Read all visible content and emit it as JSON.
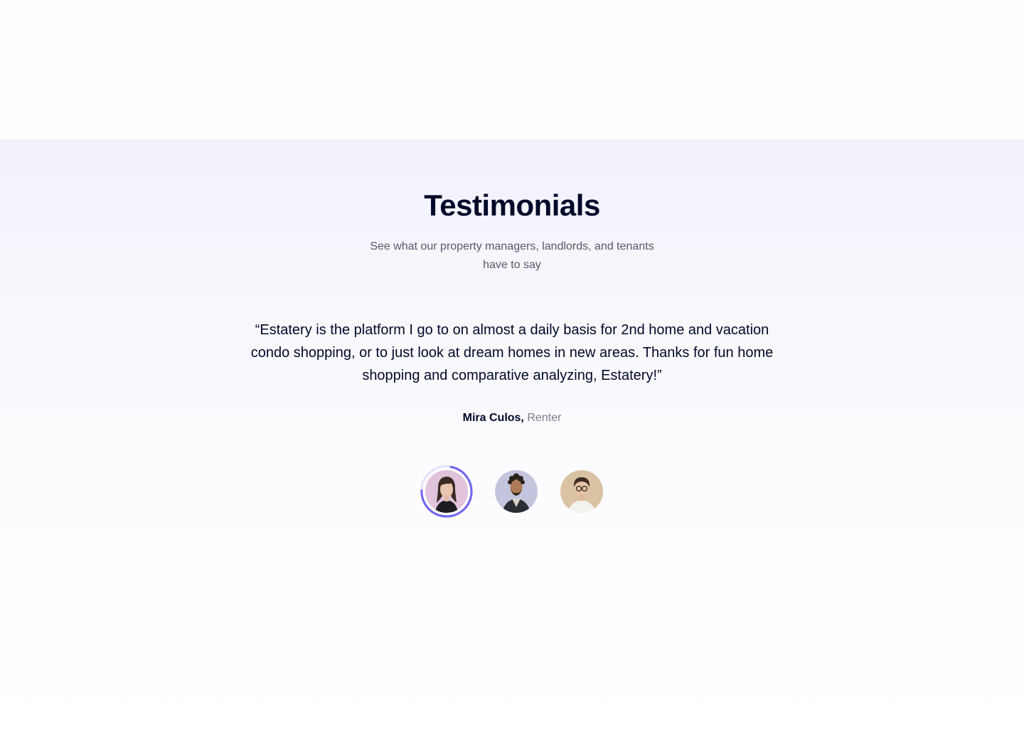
{
  "section": {
    "title": "Testimonials",
    "subtitle": "See what our property managers, landlords, and tenants have to say"
  },
  "testimonial": {
    "quote": "“Estatery is the platform I go to on almost a daily basis for 2nd home and vacation condo shopping, or to just look at dream homes in new areas. Thanks for fun home shopping and comparative analyzing, Estatery!”",
    "author_name": "Mira Culos,",
    "author_role": "Renter"
  },
  "avatars": [
    {
      "name": "avatar-mira-culos",
      "active": true
    },
    {
      "name": "avatar-curly-hair-man",
      "active": false
    },
    {
      "name": "avatar-glasses-man",
      "active": false
    }
  ],
  "colors": {
    "heading": "#000929",
    "accent": "#7065f0",
    "muted": "#7a7d8c"
  }
}
